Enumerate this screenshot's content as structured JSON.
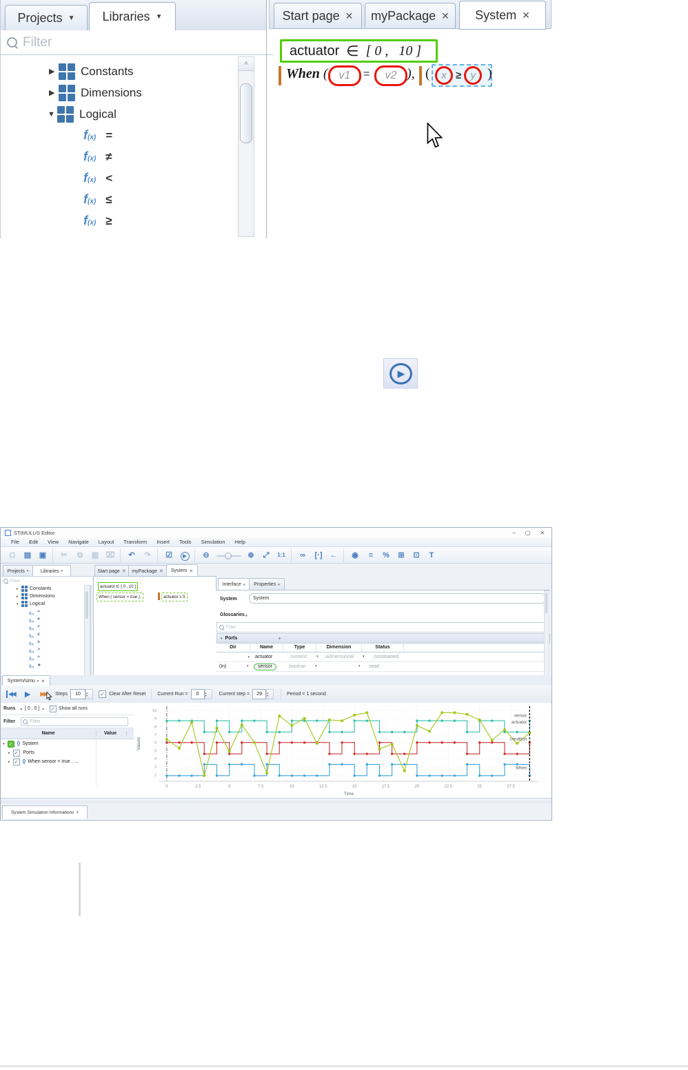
{
  "glyphs": {
    "caret": "▾",
    "caret_big": "▼",
    "close": "✕",
    "tri_right": "▶",
    "tri_down": "▼",
    "tri_right_sm": "▸",
    "tri_left_sm": "◂",
    "plus": "+",
    "check": "✓",
    "up": "▴",
    "down": "▾",
    "dots": "⋮",
    "scroll_up": "˄",
    "min": "–",
    "restore": "▢",
    "play": "▶",
    "skip": "◀◀",
    "step": "▶▶"
  },
  "colors": {
    "green_box": "#54cd07",
    "red_mark": "#e8150d",
    "orange_bar": "#c4762c",
    "selection_blue": "#5fb3e0",
    "accent_blue": "#3f7cc6",
    "check_green": "#5fc23d",
    "sensor": "#2fbfa8",
    "actuator": "#a4c717",
    "condition": "#cc3333",
    "when": "#3aa5dc"
  },
  "shot1": {
    "tab_projects": "Projects",
    "tab_libraries": "Libraries",
    "filter_placeholder": "Filter",
    "groups": [
      "Constants",
      "Dimensions",
      "Logical"
    ],
    "fx": "f",
    "fx_sub": "(x)",
    "operators": [
      "=",
      "≠",
      "<",
      "≤",
      "≥"
    ],
    "tab_start": "Start page",
    "tab_package": "myPackage",
    "tab_system": "System",
    "formula1": {
      "name": "actuator",
      "op": "∈",
      "lb": "[",
      "v0": "0",
      "comma": ",",
      "v1": "10",
      "rb": "]"
    },
    "formula2": {
      "kw": "When",
      "lp": "(",
      "v1": "v1",
      "eq": "=",
      "v2": "v2",
      "rp": "),",
      "lp2": "(",
      "x": "x",
      "ge": "≥",
      "y": "y",
      "rp2": ")"
    }
  },
  "editor": {
    "title": "STIMULUS Editor",
    "window": {
      "minimize": "–",
      "restore": "▢",
      "close": "✕"
    },
    "menus": [
      "File",
      "Edit",
      "View",
      "Navigate",
      "Layout",
      "Transform",
      "Insert",
      "Tools",
      "Simulation",
      "Help"
    ],
    "toolbar": [
      {
        "name": "new-file-icon",
        "glyph": "□"
      },
      {
        "name": "print-icon",
        "glyph": "▤"
      },
      {
        "name": "save-icon",
        "glyph": "▣"
      },
      {
        "name": "cut-icon",
        "glyph": "✂",
        "muted": true,
        "sep": true
      },
      {
        "name": "copy-icon",
        "glyph": "⧉",
        "muted": true
      },
      {
        "name": "paste-icon",
        "glyph": "▥",
        "muted": true
      },
      {
        "name": "delete-icon",
        "glyph": "⌧",
        "muted": true
      },
      {
        "name": "undo-icon",
        "glyph": "↶",
        "sep": true
      },
      {
        "name": "redo-icon",
        "glyph": "↷",
        "muted": true
      },
      {
        "name": "check-model-icon",
        "glyph": "☑",
        "sep": true
      },
      {
        "name": "run-simulation-icon",
        "glyph": "▶",
        "type": "circle"
      },
      {
        "name": "zoom-out-icon",
        "glyph": "⊖",
        "sep": true
      },
      {
        "name": "zoom-slider",
        "glyph": "·",
        "type": "slider"
      },
      {
        "name": "zoom-in-icon",
        "glyph": "⊕"
      },
      {
        "name": "fit-view-icon",
        "glyph": "⤢"
      },
      {
        "name": "zoom-ratio-label",
        "glyph": "1:1",
        "type": "ratio"
      },
      {
        "name": "link-icon",
        "glyph": "∞",
        "sep": true
      },
      {
        "name": "brackets-icon",
        "glyph": "[·]"
      },
      {
        "name": "back-arrow-icon",
        "glyph": "←"
      },
      {
        "name": "eye-icon",
        "glyph": "◉",
        "sep": true
      },
      {
        "name": "list-icon",
        "glyph": "≡"
      },
      {
        "name": "share-icon",
        "glyph": "%"
      },
      {
        "name": "diagram-icon",
        "glyph": "⊞"
      },
      {
        "name": "layers-icon",
        "glyph": "⊡"
      },
      {
        "name": "text-tool-icon",
        "glyph": "T"
      }
    ],
    "left": {
      "tab_projects": "Projects",
      "tab_libraries": "Libraries",
      "filter_placeholder": "Filter",
      "groups": [
        "Constants",
        "Dimensions",
        "Logical"
      ],
      "fx": "f",
      "fx_sub": "(x)",
      "operators": [
        "=",
        "≠",
        "<",
        "≤",
        "≥",
        ">",
        "≈",
        "∗"
      ]
    },
    "center": {
      "tab_start": "Start page",
      "tab_package": "myPackage",
      "tab_system": "System",
      "formula1": "actuator ∈ [ 0 ,  10 ]",
      "formula2a": "When ( sensor  =  true ).",
      "formula2b": "actuator ≥ 5"
    },
    "right": {
      "tab_interface": "Interface",
      "tab_properties": "Properties",
      "system_label": "System",
      "system_value": "System",
      "glossaries_label": "Glossaries",
      "add_glyph": "+",
      "filter_placeholder": "Filter",
      "ports_label": "Ports",
      "headers": [
        "Dir",
        "Name",
        "Type",
        "Dimension",
        "Status"
      ],
      "rows": [
        {
          "dir": "",
          "name": "actuator",
          "type": "numeric",
          "dimension": "adimensional",
          "status": "constrained"
        },
        {
          "dir": "(In)",
          "name": "sensor",
          "type": "boolean",
          "dimension": "",
          "status": "read"
        }
      ]
    },
    "sim": {
      "tab": "System/simu",
      "steps_label": "Steps",
      "steps": "10",
      "clear": "Clear After Reset",
      "run_label": "Current Run =",
      "run": "0",
      "step_label": "Current step =",
      "step": "29",
      "period": "Period = 1 second"
    },
    "runs": {
      "label": "Runs",
      "range": "[ 0 , 0 ]",
      "show_all": "Show all runs",
      "filter_label": "Filter",
      "filter_placeholder": "Filter",
      "name_col": "Name",
      "value_col": "Value",
      "rows": [
        "System",
        "Ports",
        "When  sensor =  true , ..."
      ]
    },
    "bottom_tab": "System Simulation Informations"
  },
  "chart_data": {
    "type": "line",
    "title": "",
    "xlabel": "Time",
    "ylabel": "Values",
    "xlim": [
      -0.6,
      29.7
    ],
    "ylim": [
      1.2,
      10.5
    ],
    "xticks": [
      0,
      2.5,
      5,
      7.5,
      10,
      12.5,
      15,
      17.5,
      20,
      22.5,
      25,
      27.5
    ],
    "yticks": [
      2,
      3,
      4,
      5,
      6,
      7,
      8,
      9,
      10
    ],
    "grid": true,
    "legend_position": "right-inline",
    "x": [
      0,
      1,
      2,
      3,
      4,
      5,
      6,
      7,
      8,
      9,
      10,
      11,
      12,
      13,
      14,
      15,
      16,
      17,
      18,
      19,
      20,
      21,
      22,
      23,
      24,
      25,
      26,
      27,
      28,
      29
    ],
    "series": [
      {
        "name": "sensor",
        "color": "#2fbfa8",
        "style": "step",
        "values": [
          8.7,
          8.7,
          8.7,
          7.3,
          8.7,
          7.3,
          8.7,
          8.7,
          7.3,
          7.3,
          8.7,
          8.7,
          8.7,
          7.3,
          7.3,
          8.7,
          8.7,
          7.3,
          7.3,
          7.3,
          8.7,
          8.7,
          8.7,
          8.7,
          7.3,
          8.7,
          8.7,
          7.3,
          7.3,
          8.7
        ]
      },
      {
        "name": "condition",
        "color": "#cc3333",
        "style": "step",
        "values": [
          6,
          6,
          6,
          4.6,
          6,
          4.6,
          6,
          6,
          4.6,
          6,
          6,
          6,
          6,
          4.6,
          6,
          4.6,
          4.6,
          6,
          4.6,
          4.6,
          6,
          6,
          6,
          6,
          4.6,
          6,
          6,
          4.6,
          4.6,
          6
        ]
      },
      {
        "name": "When",
        "color": "#3aa5dc",
        "style": "step",
        "values": [
          1.9,
          1.9,
          1.9,
          3.3,
          1.9,
          3.3,
          3.3,
          1.9,
          3.3,
          1.9,
          1.9,
          1.9,
          1.9,
          3.3,
          3.3,
          1.9,
          3.3,
          1.9,
          3.3,
          3.3,
          1.9,
          1.9,
          1.9,
          1.9,
          3.3,
          1.9,
          1.9,
          3.3,
          3.3,
          1.9
        ]
      },
      {
        "name": "actuator",
        "color": "#a4c717",
        "style": "linear",
        "values": [
          6.4,
          5.3,
          8.5,
          1.9,
          7.8,
          4.9,
          8.2,
          6.0,
          2.2,
          9.3,
          8.1,
          9.0,
          5.9,
          8.8,
          8.7,
          9.4,
          9.7,
          5.2,
          5.8,
          2.5,
          8.1,
          7.4,
          9.7,
          9.7,
          9.5,
          8.8,
          6.3,
          7.6,
          5.9,
          7.2
        ]
      }
    ],
    "right_labels": [
      {
        "text": "sensor",
        "y": 9.35
      },
      {
        "text": "actuator",
        "y": 8.55
      },
      {
        "text": "condition",
        "y": 6.45
      },
      {
        "text": "When",
        "y": 2.85
      }
    ],
    "cursor_lines": [
      {
        "x": 0,
        "style": "dashdot"
      },
      {
        "x": 29,
        "style": "dashed"
      }
    ]
  }
}
